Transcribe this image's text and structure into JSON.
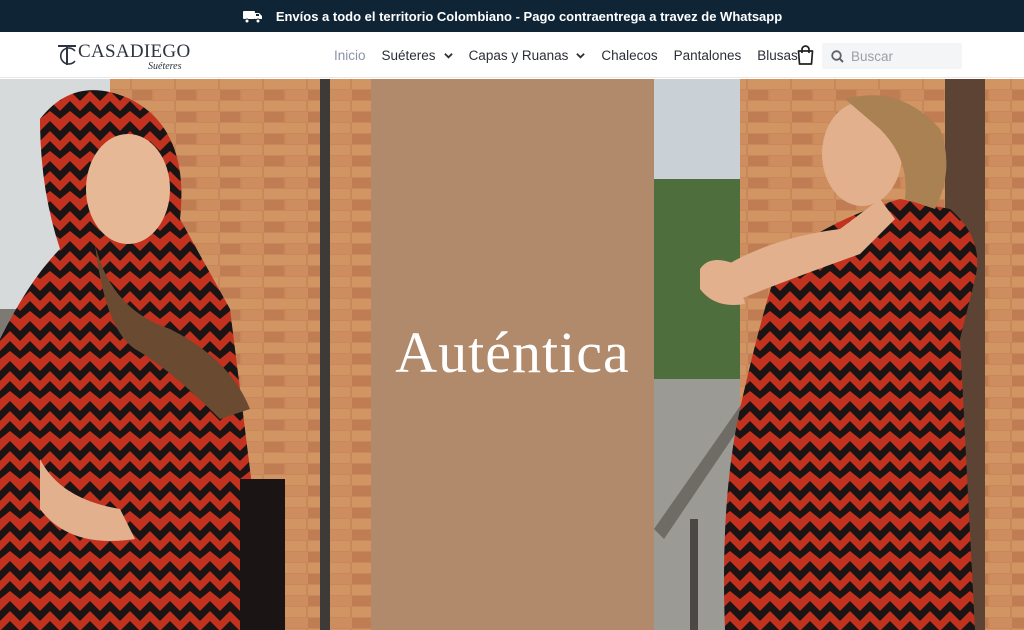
{
  "announcement": {
    "icon": "delivery-truck-icon",
    "text": "Envíos a todo el territorio Colombiano - Pago contraentrega a travez de Whatsapp"
  },
  "logo": {
    "brand": "CASADIEGO",
    "subtitle": "Suéteres",
    "monogram": "TC"
  },
  "nav": {
    "items": [
      {
        "label": "Inicio",
        "active": true,
        "dropdown": false
      },
      {
        "label": "Suéteres",
        "active": false,
        "dropdown": true
      },
      {
        "label": "Capas y Ruanas",
        "active": false,
        "dropdown": true
      },
      {
        "label": "Chalecos",
        "active": false,
        "dropdown": false
      },
      {
        "label": "Pantalones",
        "active": false,
        "dropdown": false
      },
      {
        "label": "Blusas",
        "active": false,
        "dropdown": false
      }
    ]
  },
  "cart": {
    "icon": "shopping-bag-icon"
  },
  "search": {
    "placeholder": "Buscar",
    "value": "",
    "icon": "search-icon"
  },
  "hero": {
    "title": "Auténtica",
    "panel_color": "#b08a6a"
  },
  "colors": {
    "topbar_bg": "#0f2536",
    "poncho_red": "#c2321f",
    "poncho_black": "#1a1414",
    "brick": "#c9875a"
  }
}
